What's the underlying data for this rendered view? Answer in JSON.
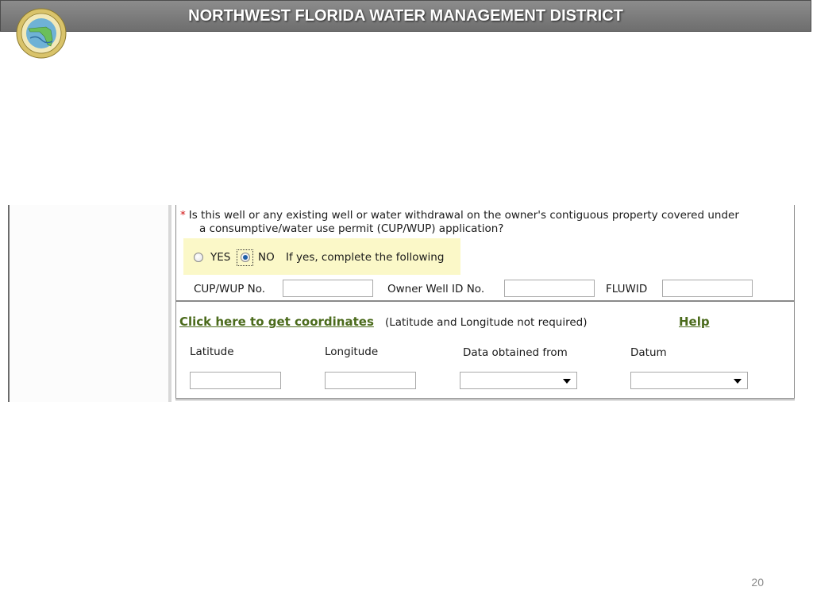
{
  "header": {
    "title": "NORTHWEST FLORIDA WATER MANAGEMENT DISTRICT",
    "logo_icon": "district-seal-logo",
    "logo_ring_text": "NORTHWEST FLORIDA WATER MANAGEMENT DISTRICT"
  },
  "question": {
    "required_marker": "*",
    "line1": "Is this well or any existing well or water withdrawal on the owner's contiguous property covered under",
    "line2": "a consumptive/water use permit (CUP/WUP) application?"
  },
  "radio_group": {
    "yes_label": "YES",
    "no_label": "NO",
    "selected": "NO",
    "hint": "If yes, complete the following"
  },
  "permit_fields": {
    "cup_label": "CUP/WUP No.",
    "cup_value": "",
    "owner_well_label": "Owner Well ID No.",
    "owner_well_value": "",
    "fluwid_label": "FLUWID",
    "fluwid_value": ""
  },
  "coordinates": {
    "link_text": "Click here to get coordinates",
    "note": "(Latitude and Longitude not required)",
    "help_text": "Help",
    "latitude_label": "Latitude",
    "latitude_value": "",
    "longitude_label": "Longitude",
    "longitude_value": "",
    "data_source_label": "Data obtained from",
    "data_source_value": "",
    "datum_label": "Datum",
    "datum_value": ""
  },
  "footer": {
    "page_number": "20"
  },
  "colors": {
    "header_bg": "#7d7d7d",
    "link_green": "#4b6b1c",
    "highlight_yellow": "#fbf8c8",
    "required_red": "#d01010"
  }
}
